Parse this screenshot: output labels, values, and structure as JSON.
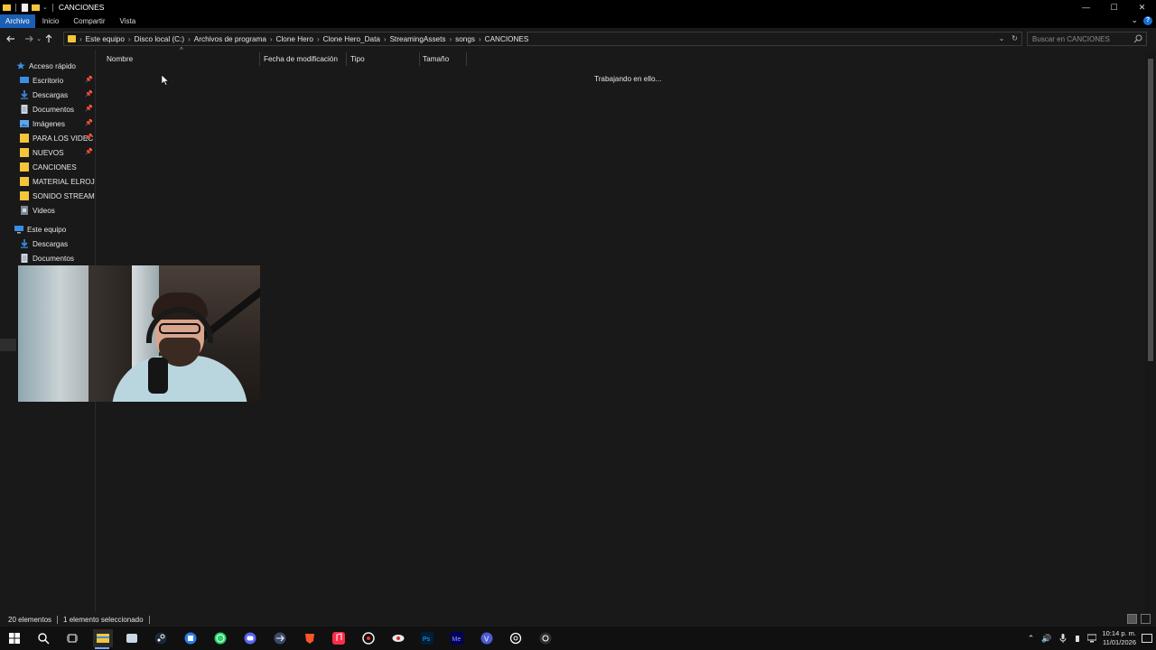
{
  "window": {
    "title": "CANCIONES",
    "controls": {
      "minimize": "—",
      "maximize": "☐",
      "close": "✕"
    }
  },
  "ribbon": {
    "tabs": [
      "Archivo",
      "Inicio",
      "Compartir",
      "Vista"
    ],
    "active_tab": "Archivo",
    "help_label": "?"
  },
  "address": {
    "crumbs": [
      "Este equipo",
      "Disco local (C:)",
      "Archivos de programa",
      "Clone Hero",
      "Clone Hero_Data",
      "StreamingAssets",
      "songs",
      "CANCIONES"
    ],
    "search_placeholder": "Buscar en CANCIONES"
  },
  "nav": {
    "quick_access_label": "Acceso rápido",
    "quick_items": [
      {
        "label": "Escritorio",
        "icon": "desktop-icon",
        "pinned": true
      },
      {
        "label": "Descargas",
        "icon": "download-icon",
        "pinned": true
      },
      {
        "label": "Documentos",
        "icon": "document-icon",
        "pinned": true
      },
      {
        "label": "Imágenes",
        "icon": "image-icon",
        "pinned": true
      },
      {
        "label": "PARA LOS VIDEC",
        "icon": "folder-icon",
        "pinned": true
      },
      {
        "label": "NUEVOS",
        "icon": "folder-icon",
        "pinned": true
      },
      {
        "label": "CANCIONES",
        "icon": "folder-icon",
        "pinned": false
      },
      {
        "label": "MATERIAL ELROJO",
        "icon": "folder-icon",
        "pinned": false
      },
      {
        "label": "SONIDO STREAM D",
        "icon": "folder-icon",
        "pinned": false
      },
      {
        "label": "Videos",
        "icon": "video-icon",
        "pinned": false
      }
    ],
    "this_pc_label": "Este equipo",
    "pc_items": [
      {
        "label": "Descargas",
        "icon": "download-icon"
      },
      {
        "label": "Documentos",
        "icon": "document-icon"
      }
    ]
  },
  "columns": [
    "Nombre",
    "Fecha de modificación",
    "Tipo",
    "Tamaño"
  ],
  "content": {
    "status_text": "Trabajando en ello..."
  },
  "status": {
    "count": "20 elementos",
    "selected": "1 elemento seleccionado"
  },
  "taskbar": {
    "apps": [
      "start-icon",
      "search-icon",
      "task-view-icon",
      "file-explorer-icon",
      "app-icon",
      "steam-icon",
      "app-icon",
      "whatsapp-icon",
      "discord-icon",
      "app-icon",
      "brave-icon",
      "music-icon",
      "app-icon",
      "app-icon",
      "photoshop-icon",
      "media-encoder-icon",
      "app-icon",
      "chatgpt-icon",
      "obs-icon"
    ],
    "clock_time": "10:14 p. m.",
    "clock_date": "11/01/2026"
  },
  "colors": {
    "accent": "#1a5fb4",
    "folder": "#f3c53a",
    "background": "#191919"
  }
}
